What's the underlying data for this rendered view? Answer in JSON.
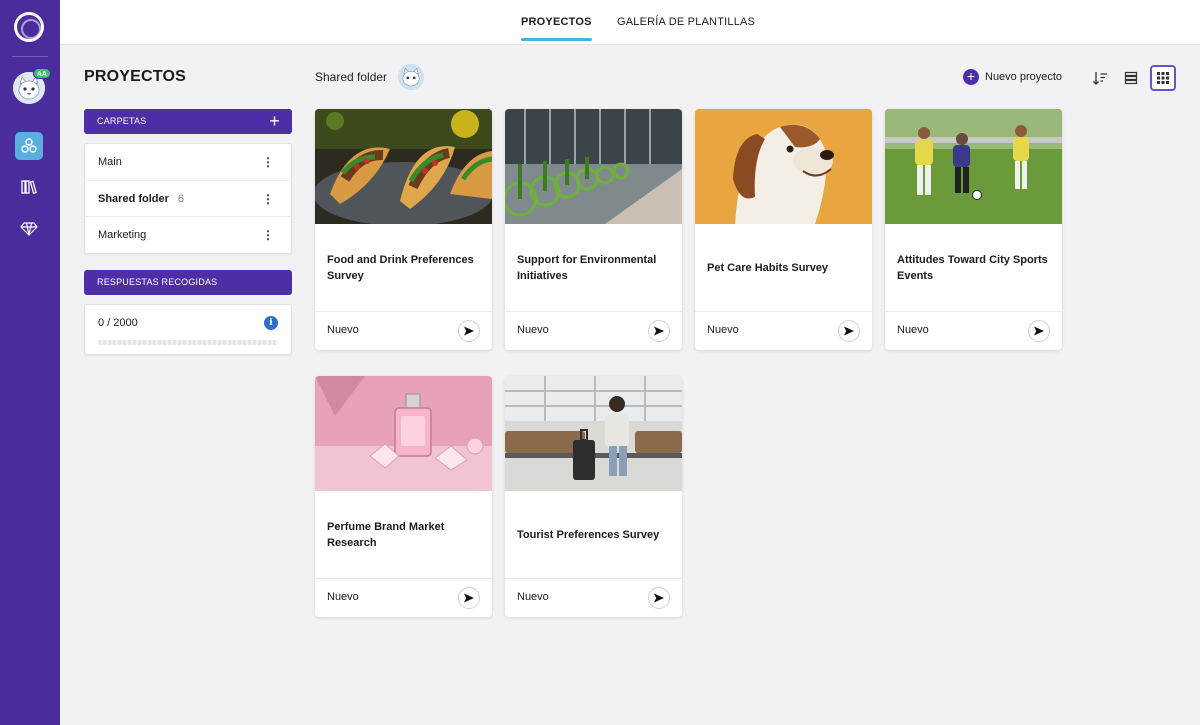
{
  "header": {
    "tabs": [
      {
        "label": "PROYECTOS",
        "active": true
      },
      {
        "label": "GALERÍA DE PLANTILLAS",
        "active": false
      }
    ]
  },
  "sidebar": {
    "title": "PROYECTOS",
    "folders_header": "CARPETAS",
    "folders": [
      {
        "label": "Main",
        "count": ""
      },
      {
        "label": "Shared folder",
        "count": "6"
      },
      {
        "label": "Marketing",
        "count": ""
      }
    ],
    "responses_header": "RESPUESTAS RECOGIDAS",
    "responses_value": "0 / 2000",
    "responses_fraction": 0,
    "avatar_badge": "AA"
  },
  "toolbar": {
    "breadcrumb": "Shared folder",
    "new_project_label": "Nuevo proyecto"
  },
  "projects": [
    {
      "title": "Food and Drink Preferences Survey",
      "status": "Nuevo",
      "image": "tacos-photo"
    },
    {
      "title": "Support for Environmental Initiatives",
      "status": "Nuevo",
      "image": "bikes-photo"
    },
    {
      "title": "Pet Care Habits Survey",
      "status": "Nuevo",
      "image": "dog-photo"
    },
    {
      "title": "Attitudes Toward City Sports Events",
      "status": "Nuevo",
      "image": "soccer-photo"
    },
    {
      "title": "Perfume Brand Market Research",
      "status": "Nuevo",
      "image": "perfume-photo"
    },
    {
      "title": "Tourist Preferences Survey",
      "status": "Nuevo",
      "image": "airport-photo"
    }
  ],
  "colors": {
    "rail": "#4a2c9c",
    "accent": "#4e2ea6",
    "tab_underline": "#49b3e0",
    "active_rail_item": "#5aaee0"
  }
}
